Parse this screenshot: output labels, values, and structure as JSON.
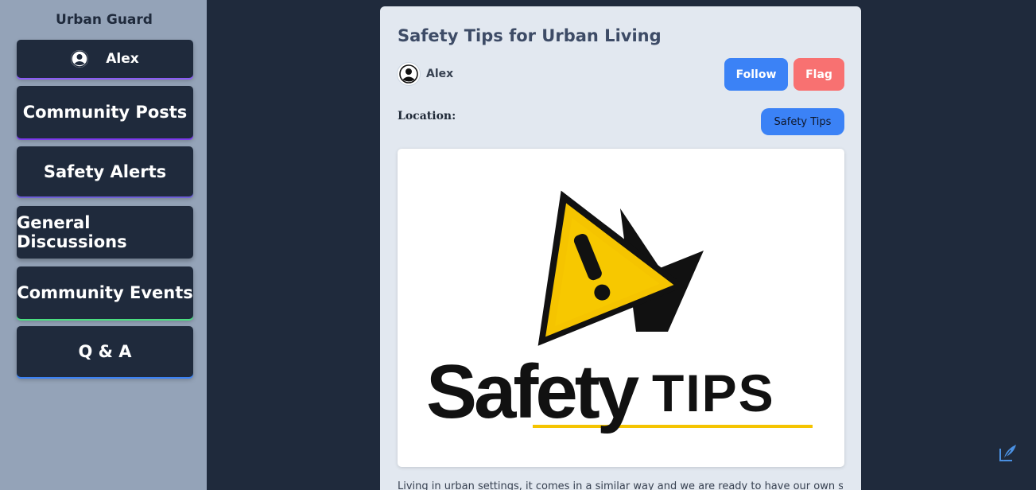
{
  "sidebar": {
    "brand": "Urban Guard",
    "user": {
      "name": "Alex",
      "icon": "user-circle-icon"
    },
    "nav": [
      {
        "label": "Community Posts"
      },
      {
        "label": "Safety Alerts"
      },
      {
        "label": "General Discussions"
      },
      {
        "label": "Community Events"
      },
      {
        "label": "Q & A"
      }
    ]
  },
  "post": {
    "title": "Safety Tips for Urban Living",
    "author": "Alex",
    "follow_label": "Follow",
    "flag_label": "Flag",
    "location_label": "Location:",
    "tag": "Safety Tips",
    "image": {
      "word1": "Safety",
      "word2": "TIPS"
    },
    "body_preview": "Living in urban settings, it comes in a similar way and we are ready to have our own safety tips for"
  },
  "colors": {
    "sidebar_bg": "#94a3b8",
    "page_bg": "#1f2a3c",
    "card_bg": "#e2e8f0",
    "follow": "#3b82f6",
    "flag": "#f87171",
    "warning_yellow": "#f5c400"
  },
  "icons": {
    "fab": "feather-pen-icon"
  }
}
